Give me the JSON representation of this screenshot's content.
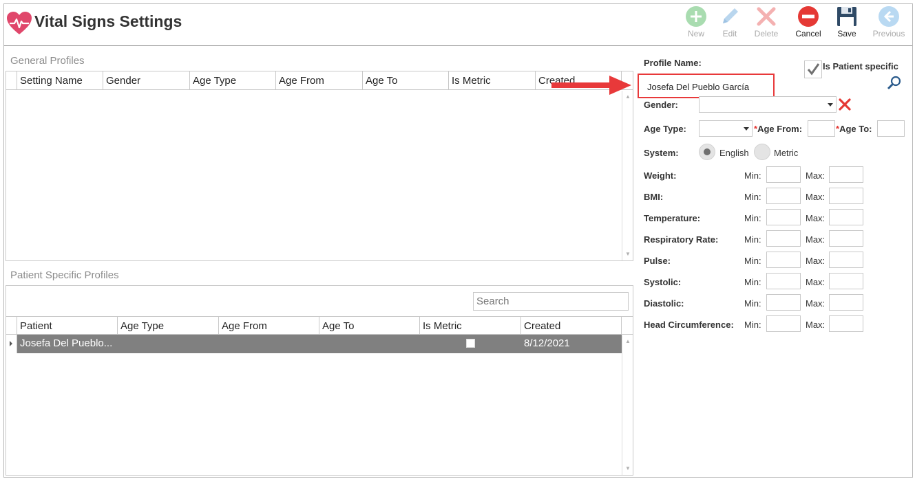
{
  "app": {
    "title": "Vital Signs Settings"
  },
  "toolbar": {
    "new_label": "New",
    "edit_label": "Edit",
    "delete_label": "Delete",
    "cancel_label": "Cancel",
    "save_label": "Save",
    "previous_label": "Previous"
  },
  "general_profiles": {
    "title": "General Profiles",
    "columns": [
      "Setting Name",
      "Gender",
      "Age Type",
      "Age From",
      "Age To",
      "Is Metric",
      "Created"
    ]
  },
  "patient_profiles": {
    "title": "Patient Specific Profiles",
    "search_placeholder": "Search",
    "columns": [
      "Patient",
      "Age Type",
      "Age From",
      "Age To",
      "Is Metric",
      "Created"
    ],
    "rows": [
      {
        "patient": "Josefa Del Pueblo...",
        "age_type": "",
        "age_from": "",
        "age_to": "",
        "is_metric": false,
        "created": "8/12/2021"
      }
    ]
  },
  "form": {
    "profile_name_label": "Profile Name:",
    "profile_name_value": "Josefa Del Pueblo García",
    "is_patient_specific_label": "Is Patient specific",
    "is_patient_specific_checked": true,
    "gender_label": "Gender:",
    "gender_value": "",
    "age_type_label": "Age Type:",
    "age_type_value": "",
    "required_mark": "*",
    "age_from_label": "Age From:",
    "age_to_label": "Age To:",
    "system_label": "System:",
    "system_options": [
      "English",
      "Metric"
    ],
    "system_selected": "English",
    "min_label": "Min:",
    "max_label": "Max:",
    "vitals": [
      "Weight:",
      "BMI:",
      "Temperature:",
      "Respiratory Rate:",
      "Pulse:",
      "Systolic:",
      "Diastolic:",
      "Head Circumference:"
    ]
  },
  "colors": {
    "accent_red": "#e8393a",
    "new_green": "#a9dcb0",
    "cancel_red": "#e53935",
    "selected_row": "#808080"
  },
  "icons": {
    "app": "heart-pulse-icon",
    "new": "plus-circle-icon",
    "edit": "pencil-icon",
    "delete": "x-icon",
    "cancel": "minus-circle-icon",
    "save": "floppy-disk-icon",
    "previous": "back-arrow-icon",
    "search": "magnifier-icon",
    "clear": "red-x-icon"
  }
}
